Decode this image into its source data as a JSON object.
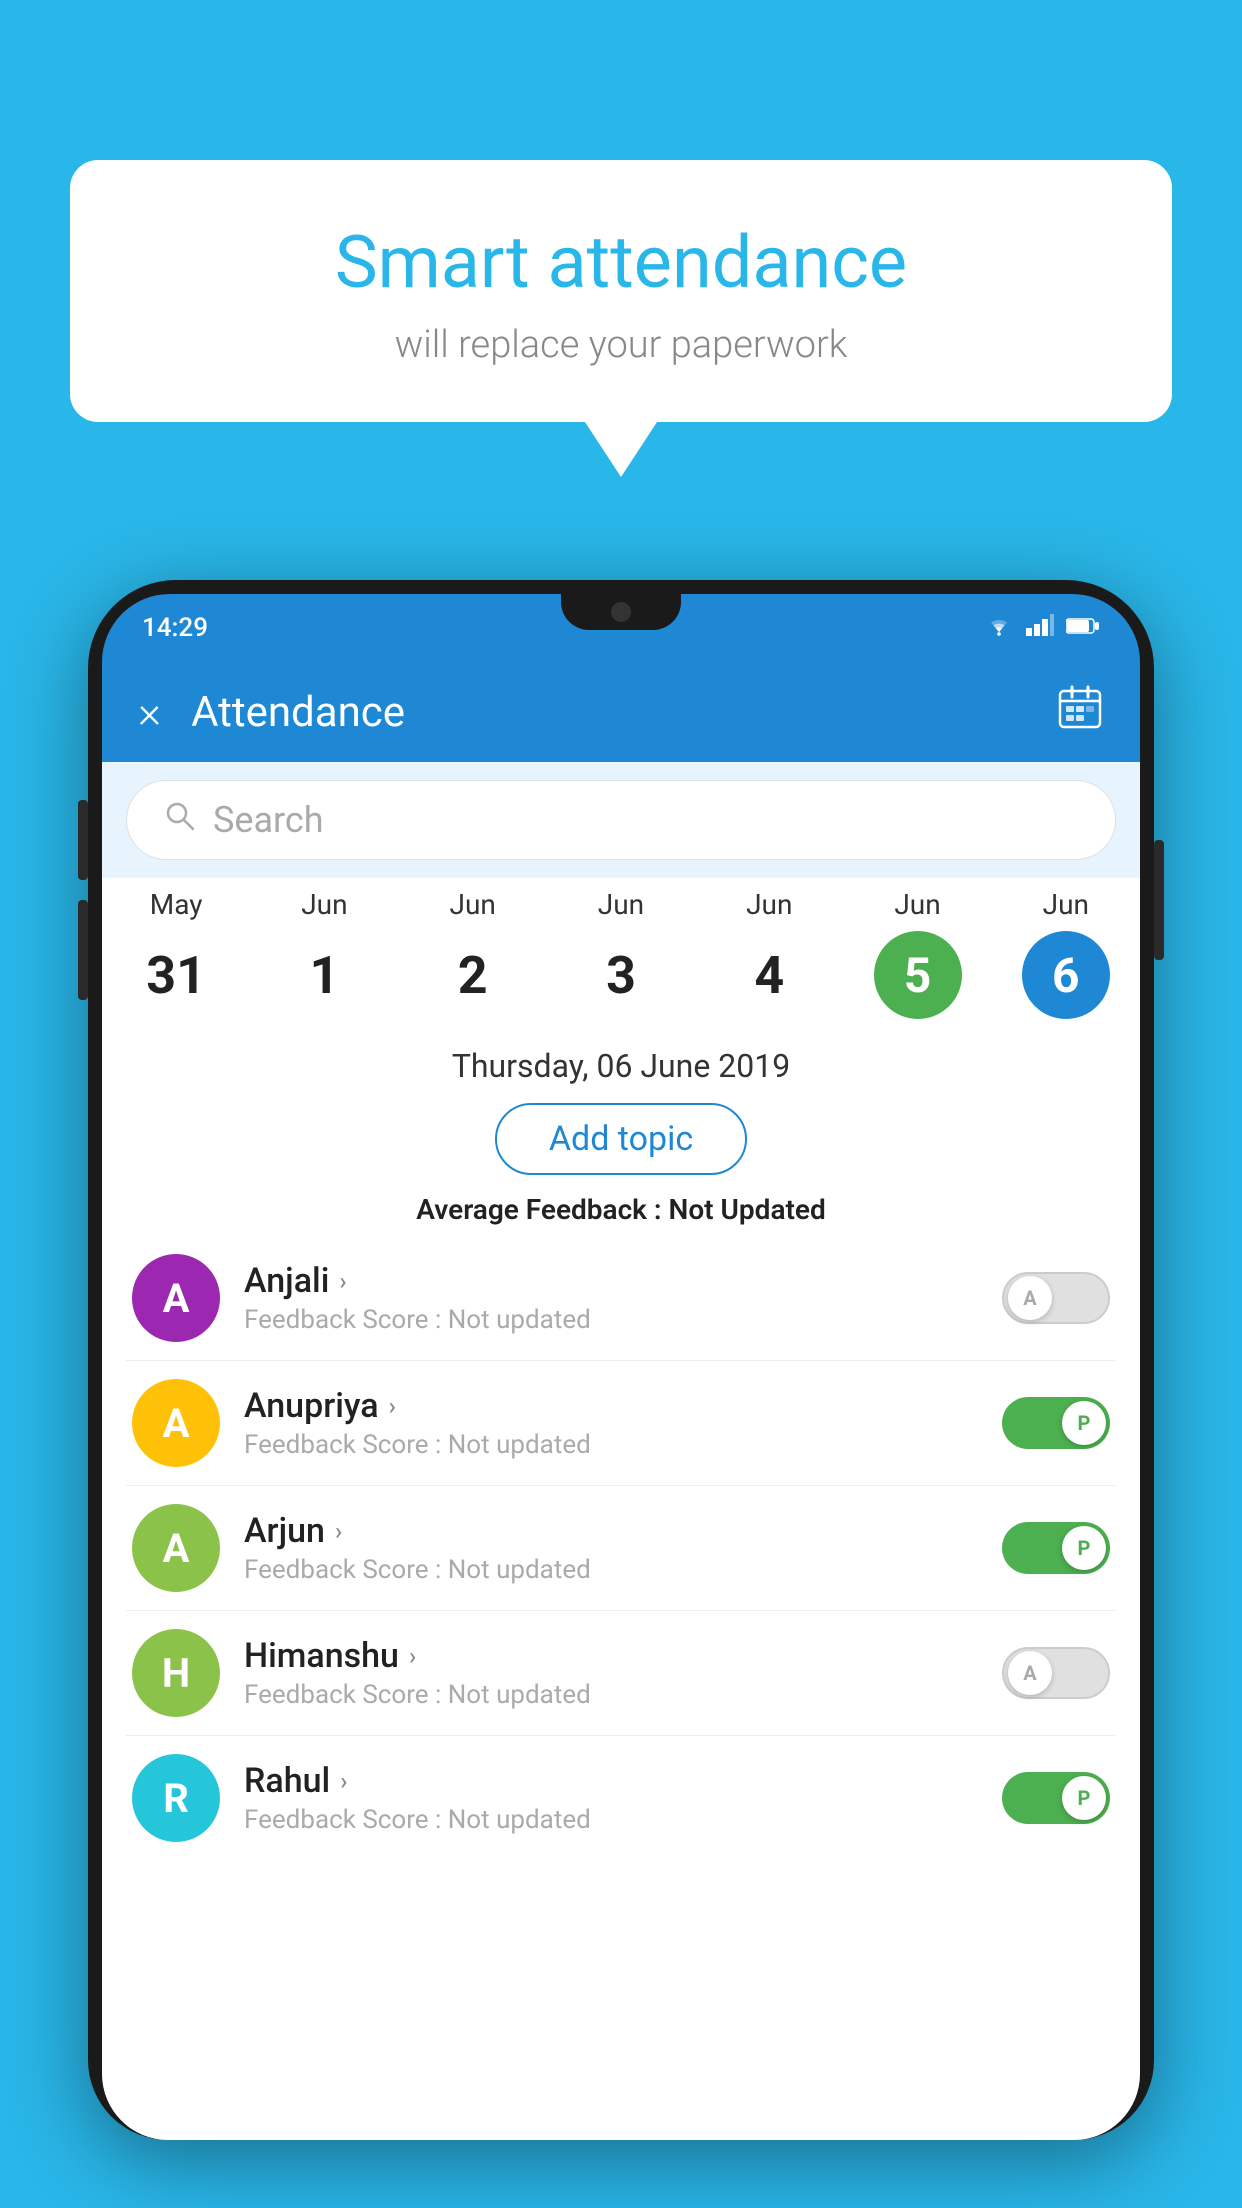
{
  "background_color": "#29b6e8",
  "speech_bubble": {
    "title": "Smart attendance",
    "subtitle": "will replace your paperwork"
  },
  "status_bar": {
    "time": "14:29",
    "icons": [
      "wifi",
      "signal",
      "battery"
    ]
  },
  "header": {
    "title": "Attendance",
    "close_label": "×",
    "calendar_label": "📅"
  },
  "search": {
    "placeholder": "Search"
  },
  "date_picker": {
    "dates": [
      {
        "month": "May",
        "day": "31",
        "state": "normal"
      },
      {
        "month": "Jun",
        "day": "1",
        "state": "normal"
      },
      {
        "month": "Jun",
        "day": "2",
        "state": "normal"
      },
      {
        "month": "Jun",
        "day": "3",
        "state": "normal"
      },
      {
        "month": "Jun",
        "day": "4",
        "state": "normal"
      },
      {
        "month": "Jun",
        "day": "5",
        "state": "today"
      },
      {
        "month": "Jun",
        "day": "6",
        "state": "selected"
      }
    ]
  },
  "info": {
    "selected_date": "Thursday, 06 June 2019",
    "add_topic_label": "Add topic",
    "avg_feedback_label": "Average Feedback : ",
    "avg_feedback_value": "Not Updated"
  },
  "students": [
    {
      "name": "Anjali",
      "avatar_letter": "A",
      "avatar_color": "#9c27b0",
      "feedback_label": "Feedback Score : ",
      "feedback_value": "Not updated",
      "toggle": "off",
      "toggle_letter": "A"
    },
    {
      "name": "Anupriya",
      "avatar_letter": "A",
      "avatar_color": "#ffc107",
      "feedback_label": "Feedback Score : ",
      "feedback_value": "Not updated",
      "toggle": "on",
      "toggle_letter": "P"
    },
    {
      "name": "Arjun",
      "avatar_letter": "A",
      "avatar_color": "#8bc34a",
      "feedback_label": "Feedback Score : ",
      "feedback_value": "Not updated",
      "toggle": "on",
      "toggle_letter": "P"
    },
    {
      "name": "Himanshu",
      "avatar_letter": "H",
      "avatar_color": "#8bc34a",
      "feedback_label": "Feedback Score : ",
      "feedback_value": "Not updated",
      "toggle": "off",
      "toggle_letter": "A"
    },
    {
      "name": "Rahul",
      "avatar_letter": "R",
      "avatar_color": "#26c6da",
      "feedback_label": "Feedback Score : ",
      "feedback_value": "Not updated",
      "toggle": "on",
      "toggle_letter": "P"
    }
  ]
}
